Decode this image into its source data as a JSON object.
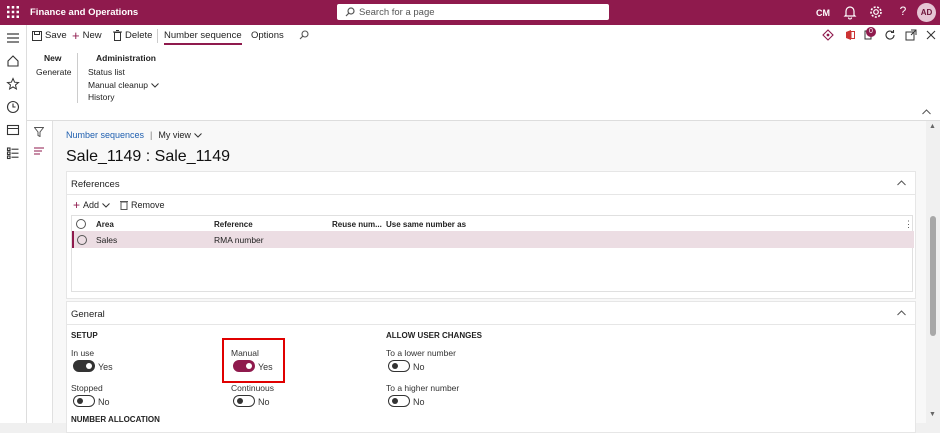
{
  "app": {
    "title": "Finance and Operations",
    "user_initials": "CM",
    "avatar_initials": "AD"
  },
  "search": {
    "placeholder": "Search for a page"
  },
  "actions": {
    "save": "Save",
    "new": "New",
    "delete": "Delete",
    "tab_number_sequence": "Number sequence",
    "tab_options": "Options"
  },
  "ribbon": {
    "new_group": {
      "header": "New",
      "items": [
        "Generate"
      ]
    },
    "admin_group": {
      "header": "Administration",
      "items": [
        "Status list",
        "Manual cleanup",
        "History"
      ]
    }
  },
  "notification_count": "0",
  "breadcrumb": {
    "link": "Number sequences",
    "sep": "|",
    "view": "My view"
  },
  "page_title": "Sale_1149 : Sale_1149",
  "references": {
    "header": "References",
    "add_label": "Add",
    "remove_label": "Remove",
    "columns": [
      "Area",
      "Reference",
      "Reuse num...",
      "Use same number as"
    ],
    "rows": [
      {
        "area": "Sales",
        "reference": "RMA number",
        "reuse": "",
        "same_as": ""
      }
    ]
  },
  "general": {
    "header": "General",
    "setup_header": "SETUP",
    "allow_header": "ALLOW USER CHANGES",
    "next_header": "NUMBER ALLOCATION",
    "fields": {
      "in_use": {
        "label": "In use",
        "value": "Yes"
      },
      "stopped": {
        "label": "Stopped",
        "value": "No"
      },
      "manual": {
        "label": "Manual",
        "value": "Yes"
      },
      "continuous": {
        "label": "Continuous",
        "value": "No"
      },
      "to_lower": {
        "label": "To a lower number",
        "value": "No"
      },
      "to_higher": {
        "label": "To a higher number",
        "value": "No"
      }
    }
  },
  "colors": {
    "brand": "#8f1a4d",
    "highlight_box": "#e00000",
    "selected_row": "#ecdde3"
  }
}
